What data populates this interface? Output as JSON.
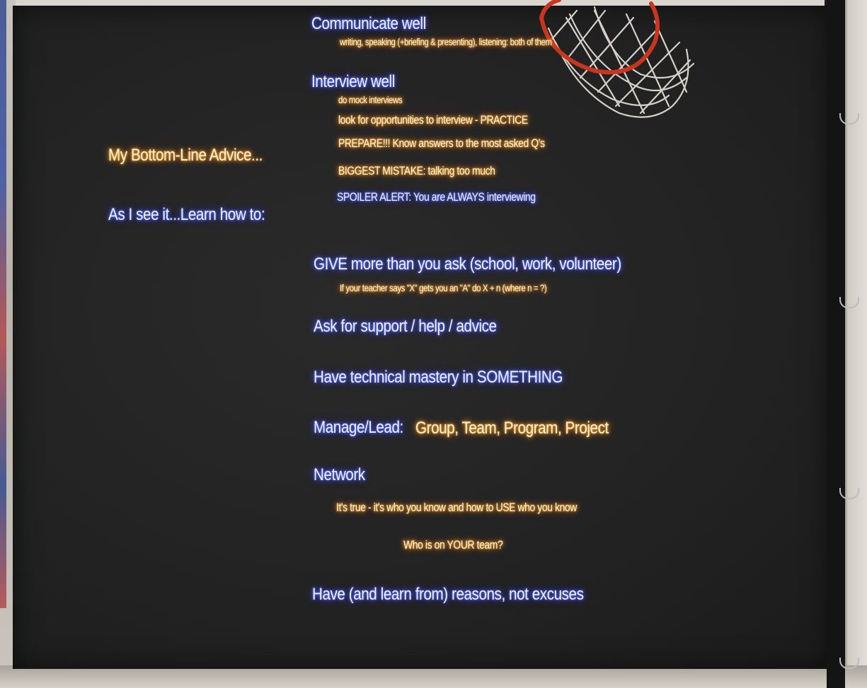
{
  "colors": {
    "blue_glow": "#4a5cff",
    "gold_glow": "#ff9a1f",
    "screen": "#232323"
  },
  "left": {
    "advice": "My Bottom-Line Advice...",
    "learn": "As I see it...Learn how to:"
  },
  "communicate": {
    "heading": "Communicate well",
    "detail": "writing, speaking (+briefing & presenting), listening: both of them"
  },
  "interview": {
    "heading": "Interview well",
    "items": [
      "do mock interviews",
      "look for opportunities to interview - PRACTICE",
      "PREPARE!!! Know answers to the most asked Q's",
      "BIGGEST MISTAKE: talking too much",
      "SPOILER ALERT: You are ALWAYS interviewing"
    ]
  },
  "give": {
    "heading": "GIVE more than you ask  (school, work, volunteer)",
    "detail": "If your teacher says \"X\" gets you an \"A\" do X + n (where n = ?)"
  },
  "ask": "Ask for support / help / advice",
  "technical": "Have technical mastery in SOMETHING",
  "manage": {
    "label": "Manage/Lead:",
    "items": "Group, Team, Program, Project"
  },
  "network": {
    "heading": "Network",
    "detail": "It's true - it's who you know and how to USE who you know",
    "question": "Who is on YOUR team?"
  },
  "reasons": "Have (and learn from) reasons, not excuses",
  "hoop_icon": "basketball-net-icon"
}
